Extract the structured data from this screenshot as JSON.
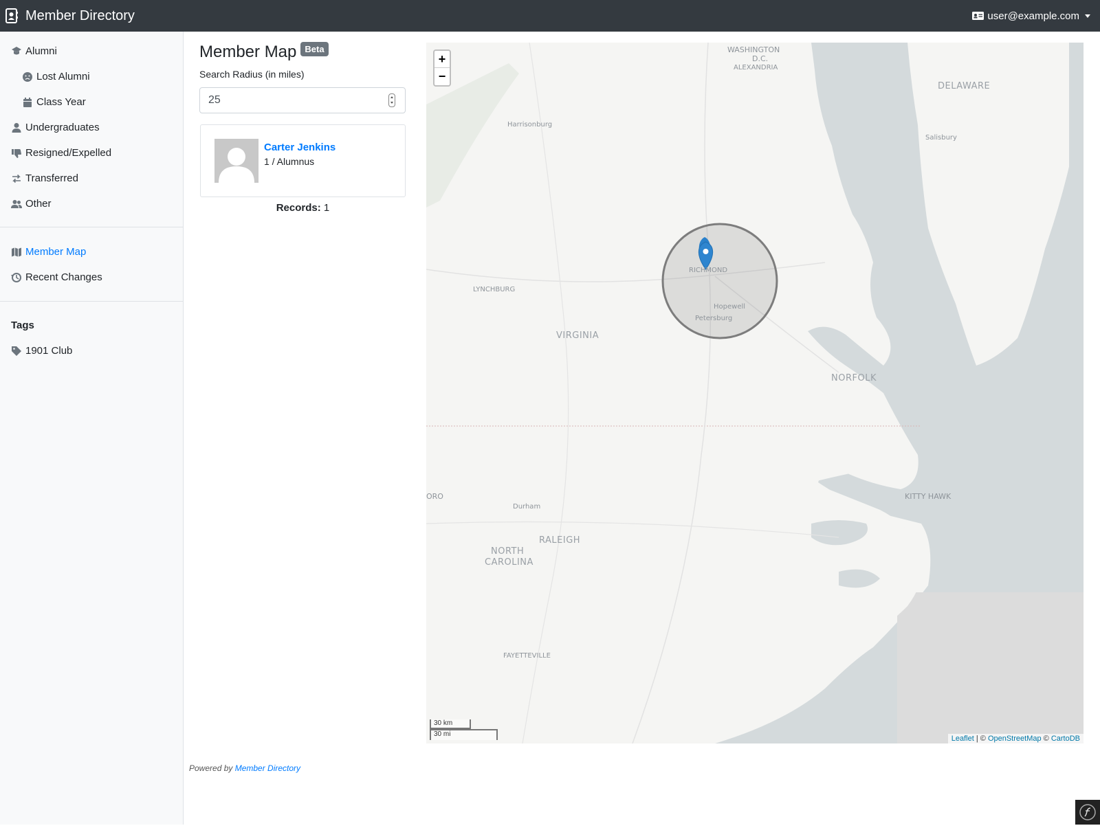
{
  "navbar": {
    "brand": "Member Directory",
    "brand_icon": "address-book-icon",
    "user_email": "user@example.com",
    "user_icon": "id-card-icon"
  },
  "sidebar": {
    "items": [
      {
        "label": "Alumni",
        "icon": "graduation-cap-icon"
      },
      {
        "label": "Lost Alumni",
        "icon": "frown-icon"
      },
      {
        "label": "Class Year",
        "icon": "calendar-icon"
      },
      {
        "label": "Undergraduates",
        "icon": "user-icon"
      },
      {
        "label": "Resigned/Expelled",
        "icon": "thumbs-down-icon"
      },
      {
        "label": "Transferred",
        "icon": "exchange-icon"
      },
      {
        "label": "Other",
        "icon": "users-icon"
      }
    ],
    "tools": [
      {
        "label": "Member Map",
        "icon": "map-icon",
        "active": true
      },
      {
        "label": "Recent Changes",
        "icon": "history-icon"
      }
    ],
    "tags_heading": "Tags",
    "tags": [
      {
        "label": "1901 Club",
        "icon": "tag-icon"
      }
    ]
  },
  "main": {
    "title": "Member Map",
    "badge": "Beta",
    "radius_label": "Search Radius (in miles)",
    "radius_value": "25",
    "member": {
      "name": "Carter Jenkins",
      "subtitle": "1 / Alumnus"
    },
    "records_label": "Records:",
    "records_count": "1"
  },
  "map": {
    "zoom_in": "+",
    "zoom_out": "−",
    "labels": {
      "washington": "WASHINGTON",
      "dc": "D.C.",
      "alexandria": "ALEXANDRIA",
      "delaware": "DELAWARE",
      "harrisonburg": "Harrisonburg",
      "salisbury": "Salisbury",
      "richmond": "RICHMOND",
      "hopewell": "Hopewell",
      "petersburg": "Petersburg",
      "lynchburg": "LYNCHBURG",
      "virginia": "VIRGINIA",
      "norfolk": "NORFOLK",
      "kitty_hawk": "KITTY HAWK",
      "oro": "ORO",
      "durham": "Durham",
      "raleigh": "RALEIGH",
      "north": "NORTH",
      "carolina": "CAROLINA",
      "fayetteville": "FAYETTEVILLE"
    },
    "scale_km": "30 km",
    "scale_mi": "30 mi",
    "attribution": {
      "leaflet": "Leaflet",
      "sep1": " | © ",
      "osm": "OpenStreetMap",
      "sep2": " © ",
      "carto": "CartoDB"
    }
  },
  "footer": {
    "prefix": "Powered by ",
    "link": "Member Directory"
  }
}
